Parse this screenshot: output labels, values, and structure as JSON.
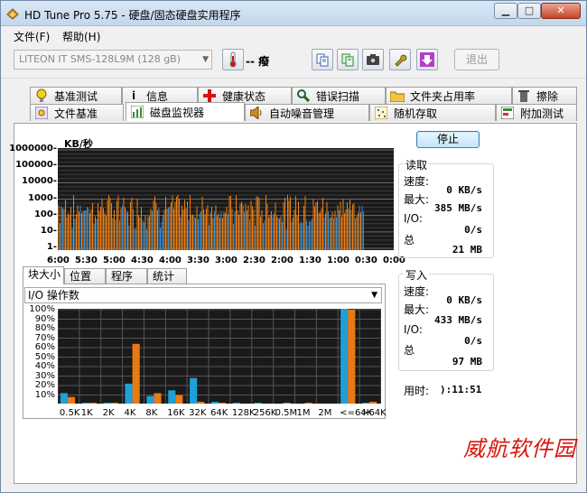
{
  "window": {
    "title": "HD Tune Pro 5.75 - 硬盘/固态硬盘实用程序",
    "min_glyph": "▁",
    "max_glyph": "□",
    "close_glyph": "✕"
  },
  "menu": {
    "file": "文件(F)",
    "help": "帮助(H)"
  },
  "toolbar": {
    "drive": "LITEON IT SMS-128L9M (128 gB)",
    "temperature": "-- 癈",
    "exit": "退出"
  },
  "tabs_row1": [
    {
      "label": "基准测试",
      "icon": "light-bulb-icon"
    },
    {
      "label": "信息",
      "icon": "info-icon"
    },
    {
      "label": "健康状态",
      "icon": "red-cross-icon"
    },
    {
      "label": "错误扫描",
      "icon": "magnifier-icon"
    },
    {
      "label": "文件夹占用率",
      "icon": "folder-icon"
    },
    {
      "label": "擦除",
      "icon": "trash-icon"
    }
  ],
  "tabs_row2": [
    {
      "label": "文件基准",
      "icon": "file-benchmark-icon"
    },
    {
      "label": "磁盘监视器",
      "icon": "monitor-chart-icon"
    },
    {
      "label": "自动噪音管理",
      "icon": "speaker-icon"
    },
    {
      "label": "随机存取",
      "icon": "random-access-icon"
    },
    {
      "label": "附加测试",
      "icon": "extra-tests-icon"
    }
  ],
  "monitor": {
    "unit": "KB/秒",
    "stop": "停止",
    "y_ticks": [
      "1000000",
      "100000",
      "10000",
      "1000",
      "100",
      "10",
      "1"
    ],
    "x_ticks": [
      "6:00",
      "5:30",
      "5:00",
      "4:30",
      "4:00",
      "3:30",
      "3:00",
      "2:30",
      "2:00",
      "1:30",
      "1:00",
      "0:30",
      "0:00"
    ]
  },
  "read": {
    "title": "读取",
    "speed_label": "速度:",
    "speed": "0 KB/s",
    "max_label": "最大:",
    "max": "385 MB/s",
    "io_label": "I/O:",
    "io": "0/s",
    "total_label": "总",
    "total": "21 MB"
  },
  "write": {
    "title": "写入",
    "speed_label": "速度:",
    "speed": "0 KB/s",
    "max_label": "最大:",
    "max": "433 MB/s",
    "io_label": "I/O:",
    "io": "0/s",
    "total_label": "总",
    "total": "97 MB"
  },
  "elapsed": {
    "label": "用时:",
    "value": "):11:51"
  },
  "subtabs": [
    "块大小",
    "位置",
    "程序",
    "统计"
  ],
  "combo": "I/O 操作数",
  "blocksize": {
    "y_ticks": [
      "100%",
      "90%",
      "80%",
      "70%",
      "60%",
      "50%",
      "40%",
      "30%",
      "20%",
      "10%"
    ],
    "x_ticks": [
      "0.5K",
      "1K",
      "2K",
      "4K",
      "8K",
      "16K",
      "32K",
      "64K",
      "128K",
      "256K",
      "0.5M",
      "1M",
      "2M",
      "<=64K",
      ">64K"
    ]
  },
  "chart_data": [
    {
      "type": "line",
      "title": "",
      "ylabel": "KB/秒",
      "y_scale": "log",
      "ylim": [
        1,
        1000000
      ],
      "x_ticks": [
        "6:00",
        "5:30",
        "5:00",
        "4:30",
        "4:00",
        "3:30",
        "3:00",
        "2:30",
        "2:00",
        "1:30",
        "1:00",
        "0:30",
        "0:00"
      ],
      "series": [],
      "grid": true
    },
    {
      "type": "bar",
      "title": "",
      "categories": [
        "0.5K",
        "1K",
        "2K",
        "4K",
        "8K",
        "16K",
        "32K",
        "64K",
        "128K",
        "256K",
        "0.5M",
        "1M",
        "2M",
        "<=64K",
        ">64K"
      ],
      "series": [
        {
          "color": "#1e9fd8",
          "values": [
            11,
            1,
            1,
            21,
            8,
            14,
            27,
            2,
            1,
            1,
            0,
            0,
            0,
            100,
            1
          ]
        },
        {
          "color": "#e87a14",
          "values": [
            7,
            1,
            1,
            63,
            11,
            9,
            2,
            1,
            0,
            0,
            1,
            1,
            0,
            99,
            2
          ]
        }
      ],
      "ylim": [
        0,
        100
      ],
      "grid": true
    }
  ],
  "watermark": "威航软件园"
}
